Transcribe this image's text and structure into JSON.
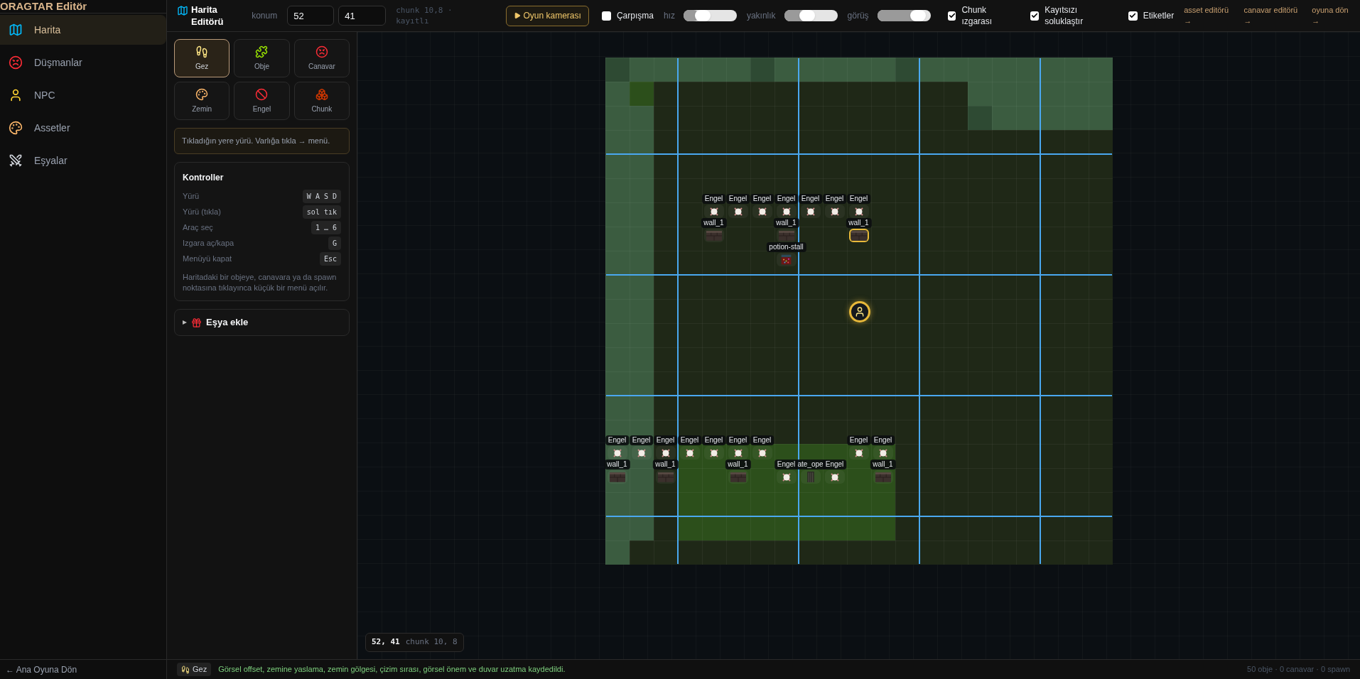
{
  "sidebar": {
    "title": "ORAGTAR Editör",
    "items": [
      {
        "label": "Harita",
        "selected": true
      },
      {
        "label": "Düşmanlar",
        "selected": false
      },
      {
        "label": "NPC",
        "selected": false
      },
      {
        "label": "Assetler",
        "selected": false
      },
      {
        "label": "Eşyalar",
        "selected": false
      }
    ],
    "back_link": "← Ana Oyuna Dön"
  },
  "toolbar": {
    "title": "Harita Editörü",
    "position_label": "konum",
    "x_value": "52",
    "y_value": "41",
    "chunk_info": "chunk 10,8 · kayıtlı",
    "camera_button": "Oyun kamerası",
    "controls": [
      {
        "kind": "checkbox",
        "label": "Çarpışma",
        "checked": false
      },
      {
        "kind": "slider",
        "label": "hız",
        "level": 0.3
      },
      {
        "kind": "slider",
        "label": "yakınlık",
        "level": 0.4
      },
      {
        "kind": "slider",
        "label": "görüş",
        "level": 0.88
      },
      {
        "kind": "checkbox",
        "label": "Chunk ızgarası",
        "checked": true
      },
      {
        "kind": "checkbox",
        "label": "Kayıtsızı soluklaştır",
        "checked": true
      },
      {
        "kind": "checkbox",
        "label": "Etiketler",
        "checked": true
      }
    ],
    "links": [
      "asset editörü →",
      "canavar editörü →",
      "oyuna dön →"
    ]
  },
  "tools": [
    {
      "label": "Gez",
      "selected": true
    },
    {
      "label": "Obje",
      "selected": false
    },
    {
      "label": "Canavar",
      "selected": false
    },
    {
      "label": "Zemin",
      "selected": false
    },
    {
      "label": "Engel",
      "selected": false
    },
    {
      "label": "Chunk",
      "selected": false
    }
  ],
  "hint": "Tıkladığın yere yürü. Varlığa tıkla → menü.",
  "controls_panel": {
    "title": "Kontroller",
    "rows": [
      {
        "label": "Yürü",
        "key": "W A S D"
      },
      {
        "label": "Yürü (tıkla)",
        "key": "sol tık"
      },
      {
        "label": "Araç seç",
        "key": "1 … 6"
      },
      {
        "label": "Izgara aç/kapa",
        "key": "G"
      },
      {
        "label": "Menüyü kapat",
        "key": "Esc"
      }
    ],
    "note": "Haritadaki bir objeye, canavara ya da spawn noktasına tıklayınca küçük bir menü açılır."
  },
  "add_item": {
    "label": "Eşya ekle",
    "expanded": false
  },
  "map": {
    "entities": [
      {
        "kind": "block",
        "label": "Engel",
        "selected": false
      },
      {
        "kind": "block",
        "label": "Engel",
        "selected": false
      },
      {
        "kind": "block",
        "label": "Engel",
        "selected": false
      },
      {
        "kind": "block",
        "label": "Engel",
        "selected": false
      },
      {
        "kind": "block",
        "label": "Engel",
        "selected": false
      },
      {
        "kind": "block",
        "label": "Engel",
        "selected": false
      },
      {
        "kind": "block",
        "label": "Engel",
        "selected": false
      },
      {
        "kind": "wall",
        "label": "wall_1",
        "selected": false
      },
      {
        "kind": "wall",
        "label": "wall_1",
        "selected": false
      },
      {
        "kind": "wall",
        "label": "wall_1",
        "selected": true
      },
      {
        "kind": "stall",
        "label": "potion-stall",
        "selected": false
      },
      {
        "kind": "player",
        "selected": false
      },
      {
        "kind": "block",
        "label": "Engel",
        "selected": false
      },
      {
        "kind": "block",
        "label": "Engel",
        "selected": false
      },
      {
        "kind": "block",
        "label": "Engel",
        "selected": false
      },
      {
        "kind": "block",
        "label": "Engel",
        "selected": false
      },
      {
        "kind": "block",
        "label": "Engel",
        "selected": false
      },
      {
        "kind": "block",
        "label": "Engel",
        "selected": false
      },
      {
        "kind": "block",
        "label": "Engel",
        "selected": false
      },
      {
        "kind": "block",
        "label": "Engel",
        "selected": false
      },
      {
        "kind": "block",
        "label": "Engel",
        "selected": false
      },
      {
        "kind": "wall",
        "label": "wall_1",
        "selected": false
      },
      {
        "kind": "wall",
        "label": "wall_1",
        "selected": false
      },
      {
        "kind": "wall",
        "label": "wall_1",
        "selected": false
      },
      {
        "kind": "block",
        "label": "Engel",
        "selected": false
      },
      {
        "kind": "gate",
        "label": "ate_ope",
        "selected": false
      },
      {
        "kind": "block",
        "label": "Engel",
        "selected": false
      },
      {
        "kind": "wall",
        "label": "wall_1",
        "selected": false
      }
    ],
    "coords": "52, 41",
    "chunk": "chunk 10, 8"
  },
  "status_bar": {
    "tool": "Gez",
    "message": "Görsel offset, zemine yaslama, zemin gölgesi, çizim sırası, görsel önem ve duvar uzatma kaydedildi.",
    "counts": "50 obje · 0 canavar · 0 spawn"
  }
}
